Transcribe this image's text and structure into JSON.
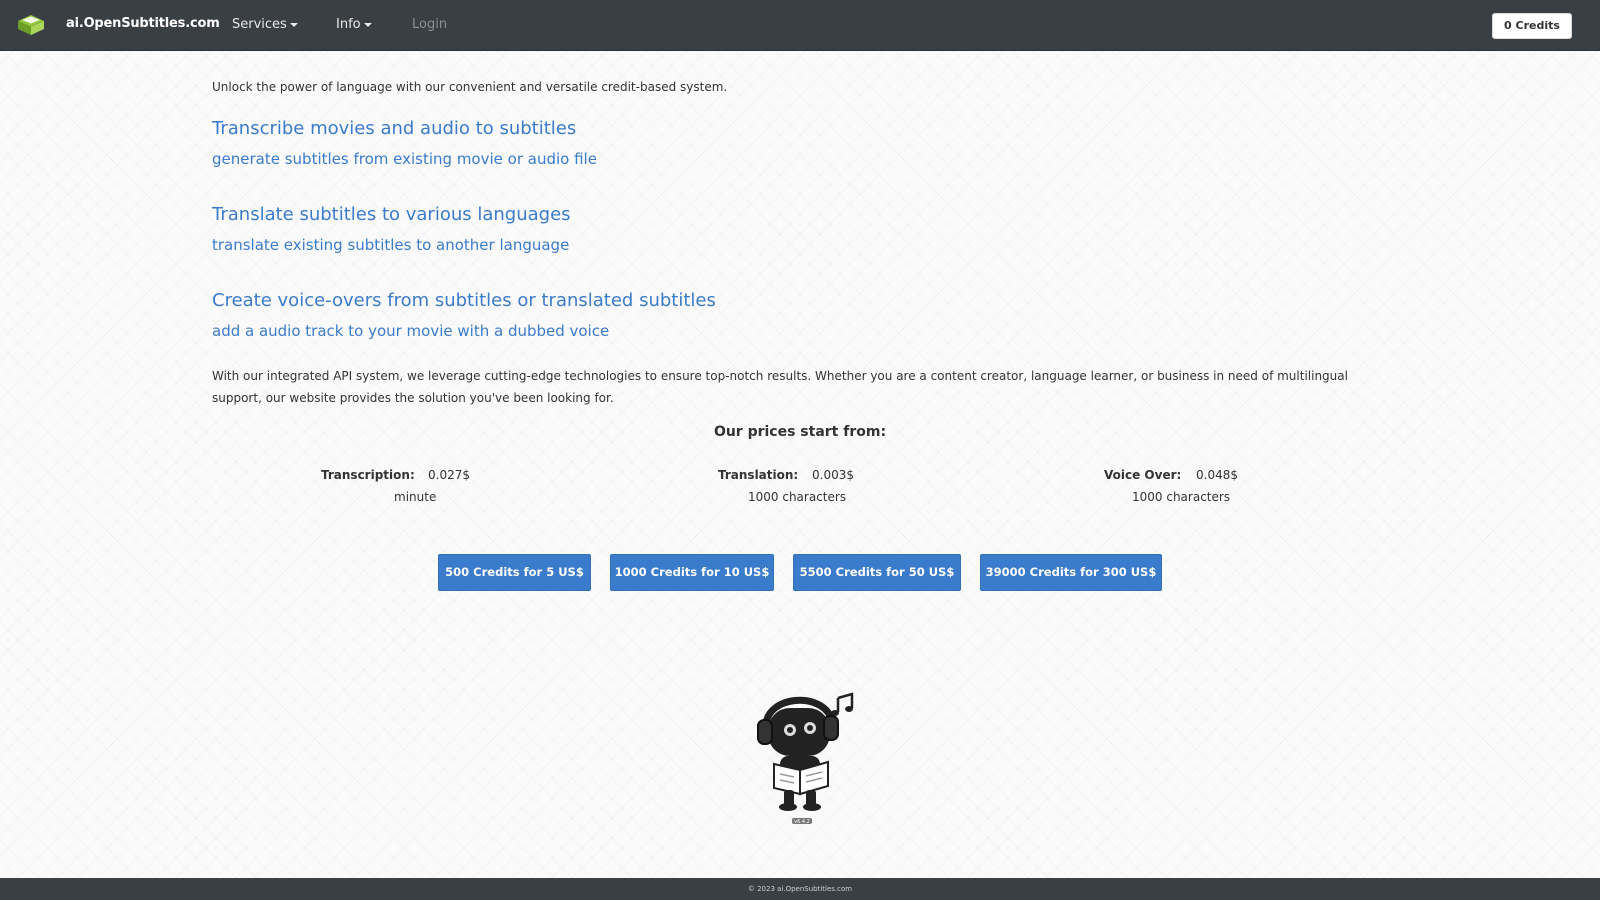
{
  "nav": {
    "brand": "ai.OpenSubtitles.com",
    "services": "Services",
    "info": "Info",
    "login": "Login",
    "credits": "0 Credits"
  },
  "intro": "Unlock the power of language with our convenient and versatile credit-based system.",
  "services": [
    {
      "title": "Transcribe movies and audio to subtitles",
      "subtitle": "generate subtitles from existing movie or audio file"
    },
    {
      "title": "Translate subtitles to various languages",
      "subtitle": "translate existing subtitles to another language"
    },
    {
      "title": "Create voice-overs from subtitles or translated subtitles",
      "subtitle": "add a audio track to your movie with a dubbed voice"
    }
  ],
  "description": "With our integrated API system, we leverage cutting-edge technologies to ensure top-notch results. Whether you are a content creator, language learner, or business in need of multilingual support, our website provides the solution you've been looking for.",
  "prices": {
    "heading": "Our prices start from:",
    "items": [
      {
        "label": "Transcription:",
        "value": "0.027$",
        "unit": "minute"
      },
      {
        "label": "Translation:",
        "value": "0.003$",
        "unit": "1000 characters"
      },
      {
        "label": "Voice Over:",
        "value": "0.048$",
        "unit": "1000 characters"
      }
    ]
  },
  "packages": [
    "500 Credits for 5 US$",
    "1000 Credits for 10 US$",
    "5500 Credits for 50 US$",
    "39000 Credits for 300 US$"
  ],
  "mascot_caption": "v6.4.2",
  "footer": "© 2023 ai.OpenSubtitles.com",
  "colors": {
    "navbar": "#3a3f44",
    "link": "#3b7bcb",
    "button": "#3b7bcb"
  }
}
